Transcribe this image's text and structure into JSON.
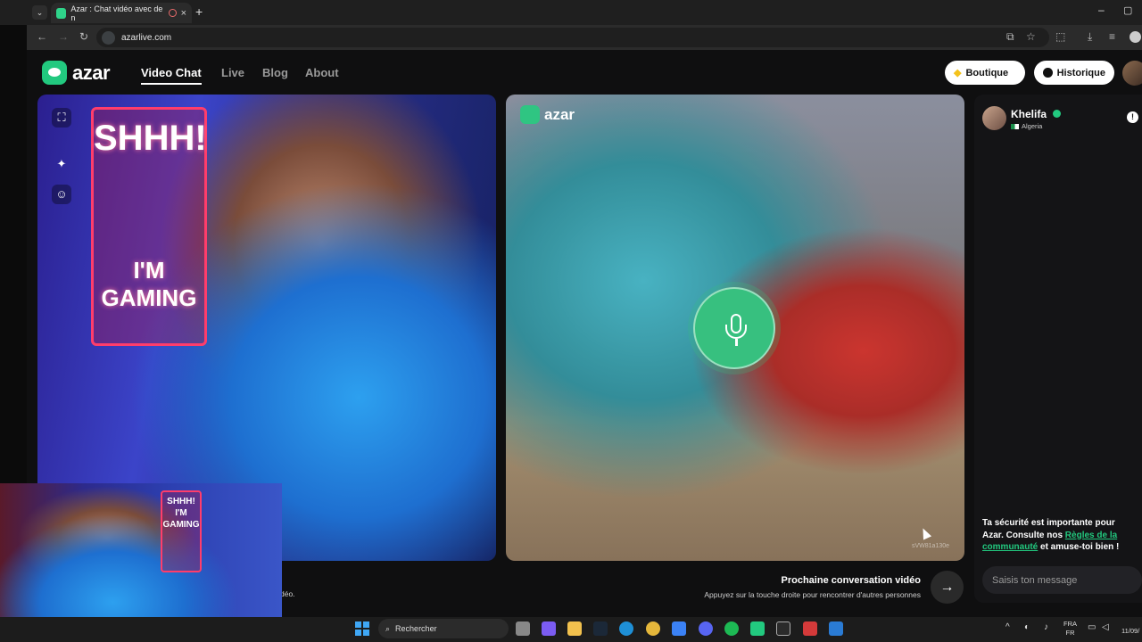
{
  "browser": {
    "tab_title": "Azar : Chat vidéo avec de n",
    "url": "azarlive.com"
  },
  "site": {
    "logo_text": "azar",
    "nav": [
      "Video Chat",
      "Live",
      "Blog",
      "About"
    ],
    "boutique_label": "Boutique",
    "historique_label": "Historique"
  },
  "local_video": {
    "sign_line1": "SHHH!",
    "sign_line2": "I'M",
    "sign_line3": "GAMING"
  },
  "remote_video": {
    "logo_text": "azar",
    "watermark": "sVW81a130e"
  },
  "next": {
    "title": "Prochaine conversation vidéo",
    "subtitle": "Appuyez sur la touche droite pour rencontrer d'autres personnes",
    "partial_text": "déo."
  },
  "chat": {
    "partner_name": "Khelifa",
    "partner_country": "Algeria",
    "safety_prefix": "Ta sécurité est importante pour Azar. Consulte nos ",
    "safety_link": "Règles de la communauté",
    "safety_suffix": " et amuse-toi bien !",
    "input_placeholder": "Saisis ton message"
  },
  "pip": {
    "sign_text": "SHHH! I'M GAMING"
  },
  "taskbar": {
    "search_placeholder": "Rechercher",
    "lang_top": "FRA",
    "lang_bottom": "FR",
    "date": "11/09/"
  },
  "colors": {
    "brand_green": "#22c97f",
    "background": "#0f0f10"
  }
}
